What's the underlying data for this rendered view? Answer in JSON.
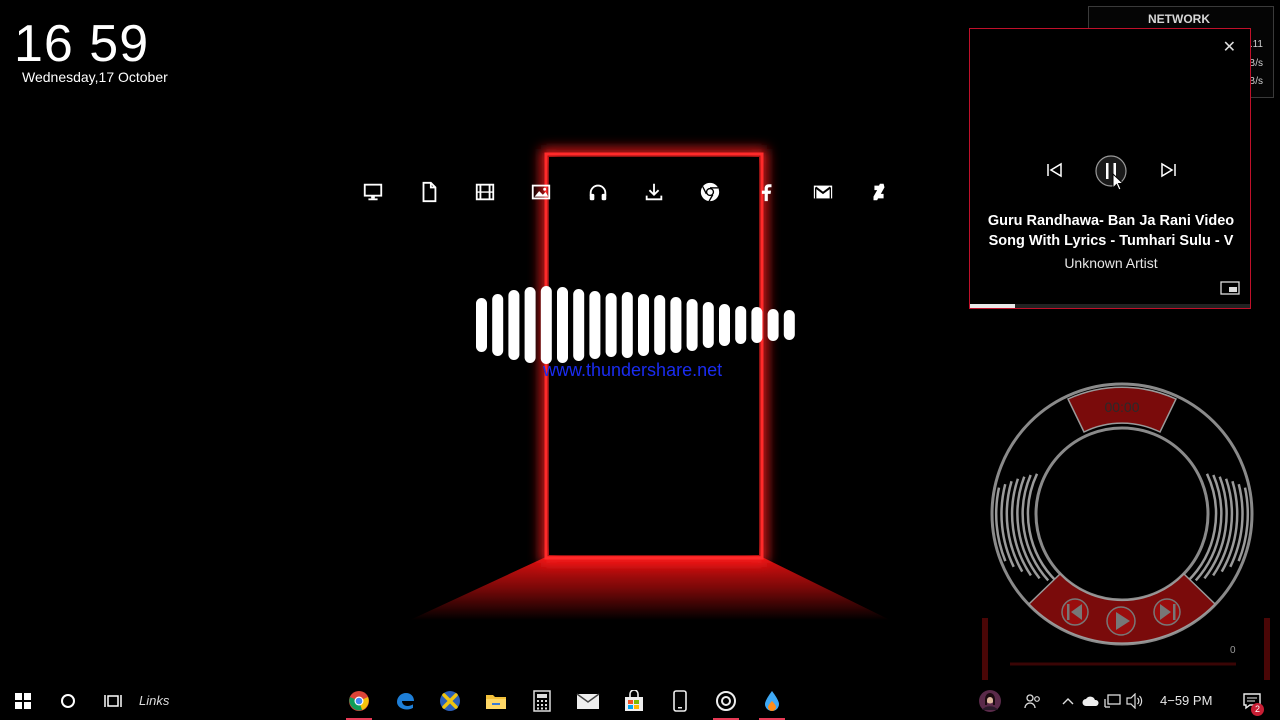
{
  "clock": {
    "time": "16 59",
    "date": "Wednesday,17 October"
  },
  "quick_icons": [
    "monitor-icon",
    "document-icon",
    "film-icon",
    "image-icon",
    "headphones-icon",
    "download-icon",
    "chrome-icon",
    "facebook-icon",
    "gmail-icon",
    "deviantart-icon"
  ],
  "watermark": "www.thundershare.net",
  "network": {
    "title": "NETWORK",
    "values": [
      ".11",
      "B/s",
      "B/s"
    ]
  },
  "media": {
    "title_line1": "Guru Randhawa- Ban Ja Rani Video",
    "title_line2": "Song With Lyrics - Tumhari Sulu - V",
    "artist": "Unknown Artist",
    "progress": 0.16,
    "state": "playing"
  },
  "circular_player": {
    "time": "00:00",
    "volume": "0"
  },
  "taskbar": {
    "links_label": "Links",
    "tray_time": "4−59 PM",
    "notification_count": "2",
    "pinned": [
      "chrome-icon",
      "edge-icon",
      "xbox-icon",
      "file-explorer-icon",
      "calculator-icon",
      "mail-icon",
      "store-icon",
      "phone-icon",
      "groove-icon",
      "droplet-icon"
    ]
  },
  "colors": {
    "accent_red": "#e0101e",
    "border_red": "#c0102a",
    "grey_ring": "#8a8a8a"
  }
}
